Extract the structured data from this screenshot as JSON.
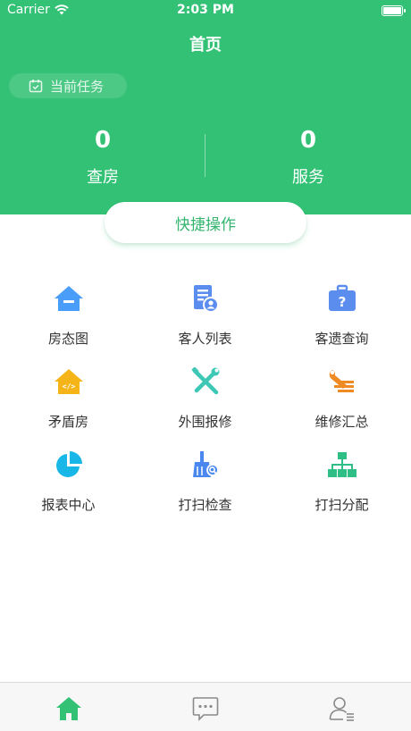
{
  "status_bar": {
    "carrier": "Carrier",
    "time": "2:03 PM"
  },
  "nav": {
    "title": "首页"
  },
  "task": {
    "label": "当前任务"
  },
  "stats": [
    {
      "value": "0",
      "label": "查房"
    },
    {
      "value": "0",
      "label": "服务"
    }
  ],
  "quick_actions": {
    "label": "快捷操作"
  },
  "grid": [
    {
      "label": "房态图",
      "icon": "house-icon",
      "color": "#4a9df8"
    },
    {
      "label": "客人列表",
      "icon": "guest-list-icon",
      "color": "#5b8def"
    },
    {
      "label": "客遗查询",
      "icon": "lost-items-icon",
      "color": "#5b8def"
    },
    {
      "label": "矛盾房",
      "icon": "conflict-house-icon",
      "color": "#f5b418"
    },
    {
      "label": "外围报修",
      "icon": "tools-icon",
      "color": "#3cc8b4"
    },
    {
      "label": "维修汇总",
      "icon": "wrench-summary-icon",
      "color": "#f08a24"
    },
    {
      "label": "报表中心",
      "icon": "pie-chart-icon",
      "color": "#18b7e8"
    },
    {
      "label": "打扫检查",
      "icon": "broom-search-icon",
      "color": "#4a88f0"
    },
    {
      "label": "打扫分配",
      "icon": "org-chart-icon",
      "color": "#2fbf86"
    }
  ],
  "tabbar": {
    "items": [
      {
        "icon": "home-icon",
        "active": true
      },
      {
        "icon": "message-icon",
        "active": false
      },
      {
        "icon": "profile-icon",
        "active": false
      }
    ],
    "active_color": "#33c275",
    "inactive_color": "#8a8a8a"
  },
  "colors": {
    "brand": "#33c275"
  }
}
